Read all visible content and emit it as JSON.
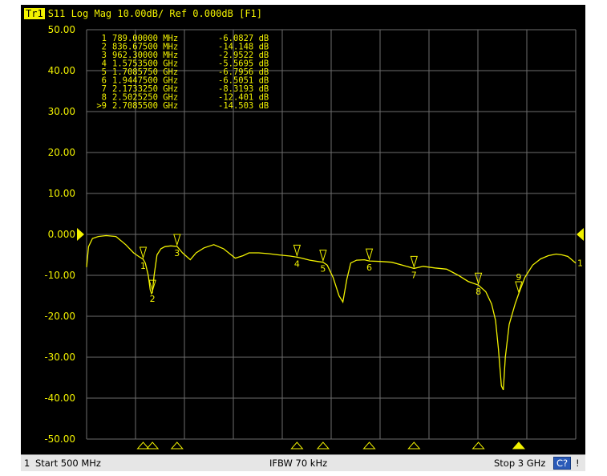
{
  "header": {
    "trace_tag": "Tr1",
    "text": "S11 Log Mag 10.00dB/ Ref 0.000dB [F1]"
  },
  "chart_data": {
    "type": "line",
    "title": "",
    "xlabel": "",
    "ylabel": "",
    "xlim_mhz": [
      500,
      3000
    ],
    "ylim": [
      -50,
      50
    ],
    "y_ticks": [
      50,
      40,
      30,
      20,
      10,
      0,
      -10,
      -20,
      -30,
      -40,
      -50
    ],
    "y_tick_labels": [
      "50.00",
      "40.00",
      "30.00",
      "20.00",
      "10.00",
      "0.000",
      "-10.00",
      "-20.00",
      "-30.00",
      "-40.00",
      "-50.00"
    ],
    "grid": true,
    "reference_level": 0,
    "series": [
      {
        "color": "#f2f200",
        "x": [
          500,
          510,
          530,
          560,
          600,
          650,
          700,
          740,
          770,
          789,
          800,
          815,
          825,
          832,
          836.675,
          845,
          860,
          880,
          900,
          930,
          962.3,
          990,
          1030,
          1060,
          1100,
          1150,
          1200,
          1260,
          1300,
          1330,
          1380,
          1430,
          1480,
          1540,
          1575.35,
          1600,
          1640,
          1680,
          1708.575,
          1730,
          1760,
          1790,
          1810,
          1830,
          1850,
          1880,
          1920,
          1944.75,
          2000,
          2060,
          2120,
          2173.325,
          2220,
          2280,
          2340,
          2400,
          2450,
          2502.525,
          2540,
          2570,
          2590,
          2605,
          2620,
          2630,
          2640,
          2660,
          2690,
          2708.55,
          2740,
          2780,
          2820,
          2860,
          2900,
          2930,
          2960,
          3000
        ],
        "y": [
          -8,
          -3,
          -1,
          -0.5,
          -0.3,
          -0.5,
          -2.5,
          -4.5,
          -5.5,
          -6.08,
          -7,
          -10,
          -13.5,
          -14.5,
          -14.15,
          -10,
          -5,
          -3.5,
          -3,
          -2.8,
          -2.95,
          -4.5,
          -6.2,
          -4.5,
          -3.3,
          -2.5,
          -3.5,
          -5.8,
          -5.2,
          -4.5,
          -4.5,
          -4.7,
          -5,
          -5.3,
          -5.57,
          -5.8,
          -6.3,
          -6.6,
          -6.8,
          -7.5,
          -10.5,
          -15,
          -16.5,
          -11,
          -7,
          -6.3,
          -6.2,
          -6.5,
          -6.6,
          -6.8,
          -7.6,
          -8.32,
          -7.8,
          -8.2,
          -8.5,
          -10,
          -11.5,
          -12.4,
          -14,
          -17,
          -21,
          -28,
          -37,
          -38,
          -30,
          -22,
          -17,
          -14.5,
          -10.5,
          -7.5,
          -6,
          -5.2,
          -4.8,
          -5,
          -5.4,
          -7
        ]
      }
    ],
    "markers": [
      {
        "id": "1",
        "list_label": "1",
        "freq": "789.00000 MHz",
        "freq_mhz": 789,
        "value": "-6.0827 dB",
        "db": -6.0827
      },
      {
        "id": "2",
        "list_label": "2",
        "freq": "836.67500 MHz",
        "freq_mhz": 836.675,
        "value": "-14.148 dB",
        "db": -14.148
      },
      {
        "id": "3",
        "list_label": "3",
        "freq": "962.30000 MHz",
        "freq_mhz": 962.3,
        "value": "-2.9522 dB",
        "db": -2.9522
      },
      {
        "id": "4",
        "list_label": "4",
        "freq": "1.5753500 GHz",
        "freq_mhz": 1575.35,
        "value": "-5.5695 dB",
        "db": -5.5695
      },
      {
        "id": "5",
        "list_label": "5",
        "freq": "1.7085750 GHz",
        "freq_mhz": 1708.575,
        "value": "-6.7956 dB",
        "db": -6.7956
      },
      {
        "id": "6",
        "list_label": "6",
        "freq": "1.9447500 GHz",
        "freq_mhz": 1944.75,
        "value": "-6.5051 dB",
        "db": -6.5051
      },
      {
        "id": "7",
        "list_label": "7",
        "freq": "2.1733250 GHz",
        "freq_mhz": 2173.325,
        "value": "-8.3193 dB",
        "db": -8.3193
      },
      {
        "id": "8",
        "list_label": "8",
        "freq": "2.5025250 GHz",
        "freq_mhz": 2502.525,
        "value": "-12.401 dB",
        "db": -12.401
      },
      {
        "id": "9",
        "list_label": ">9",
        "freq": "2.7085500 GHz",
        "freq_mhz": 2708.55,
        "value": "-14.503 dB",
        "db": -14.503
      }
    ],
    "active_marker": "9",
    "trace_end_label": "1"
  },
  "colors": {
    "trace": "#f2f200",
    "grid": "#6e6e6e",
    "background": "#000000",
    "reference_arrow": "#f2f200"
  },
  "statusbar": {
    "channel": "1",
    "start": "Start 500 MHz",
    "ifbw": "IFBW 70 kHz",
    "stop": "Stop 3 GHz",
    "cal": "C?",
    "excl": "!"
  }
}
